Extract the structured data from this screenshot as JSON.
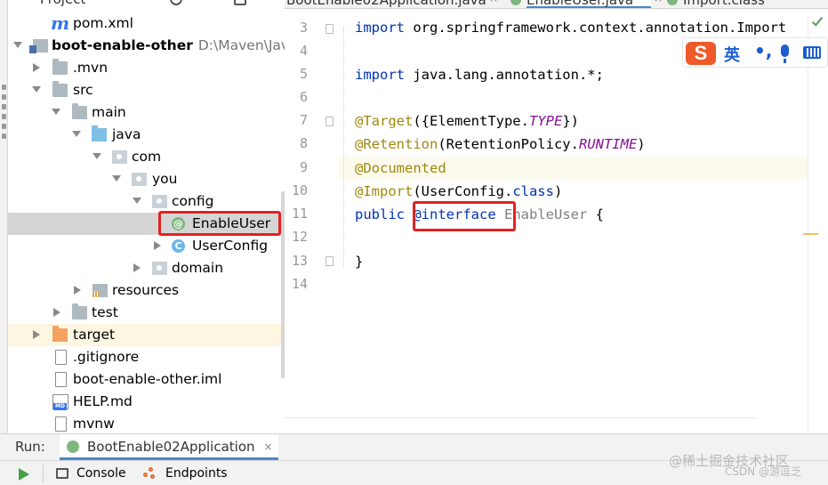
{
  "project_panel": {
    "header_title": "Project",
    "tree": [
      {
        "label": "pom.xml",
        "icon": "maven-m-icon"
      },
      {
        "label": "boot-enable-other",
        "path": "D:\\Maven\\JavaV",
        "icon": "module-folder-icon"
      },
      {
        "label": ".mvn",
        "icon": "folder-icon"
      },
      {
        "label": "src",
        "icon": "folder-icon"
      },
      {
        "label": "main",
        "icon": "folder-icon"
      },
      {
        "label": "java",
        "icon": "source-folder-icon"
      },
      {
        "label": "com",
        "icon": "package-icon"
      },
      {
        "label": "you",
        "icon": "package-icon"
      },
      {
        "label": "config",
        "icon": "package-icon"
      },
      {
        "label": "EnableUser",
        "icon": "annotation-icon",
        "icon_glyph": "@"
      },
      {
        "label": "UserConfig",
        "icon": "class-icon",
        "icon_glyph": "C"
      },
      {
        "label": "domain",
        "icon": "package-icon"
      },
      {
        "label": "resources",
        "icon": "resources-folder-icon"
      },
      {
        "label": "test",
        "icon": "folder-icon"
      },
      {
        "label": "target",
        "icon": "excluded-folder-icon"
      },
      {
        "label": ".gitignore",
        "icon": "file-icon"
      },
      {
        "label": "boot-enable-other.iml",
        "icon": "file-icon"
      },
      {
        "label": "HELP.md",
        "icon": "markdown-icon"
      },
      {
        "label": "mvnw",
        "icon": "file-icon"
      }
    ]
  },
  "editor": {
    "tabs": [
      {
        "label": "BootEnable02Application.java"
      },
      {
        "label": "EnableUser.java",
        "active": true
      },
      {
        "label": "Import.class"
      }
    ],
    "line_numbers": [
      "3",
      "4",
      "5",
      "6",
      "7",
      "8",
      "9",
      "10",
      "11",
      "12",
      "13",
      "14"
    ],
    "code": {
      "l3_kw": "import",
      "l3_rest": " org.springframework.context.annotation.Import",
      "l5_kw": "import",
      "l5_rest": " java.lang.annotation.*;",
      "l7_an": "@Target",
      "l7_a": "({ElementType.",
      "l7_it": "TYPE",
      "l7_b": "})",
      "l8_an": "@Retention",
      "l8_a": "(RetentionPolicy.",
      "l8_it": "RUNTIME",
      "l8_b": ")",
      "l9_an": "@Documented",
      "l10_an": "@Import",
      "l10_a": "(UserConfig.",
      "l10_kw": "class",
      "l10_b": ")",
      "l11_kw1": "public",
      "l11_sp": " ",
      "l11_kw2": "@interface",
      "l11_sp2": " ",
      "l11_name": "EnableUser",
      "l11_brace": " {",
      "l13": "}"
    }
  },
  "ime": {
    "logo": "S",
    "lang": "英",
    "punct": "•,"
  },
  "run_bar": {
    "label": "Run:",
    "tab": "BootEnable02Application",
    "close": "×"
  },
  "bottom_toolbar": {
    "console": "Console",
    "endpoints": "Endpoints"
  },
  "watermark": {
    "line1": "@稀土掘金技术社区",
    "line2": "CSDN @游逗乏"
  },
  "colors": {
    "highlight_box": "#e52020",
    "keyword": "#0033b3",
    "annotation": "#9e880d",
    "constant": "#871094"
  }
}
